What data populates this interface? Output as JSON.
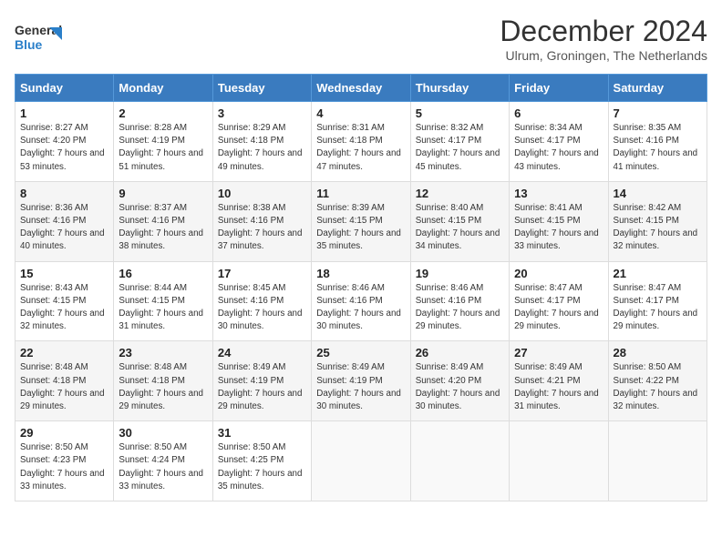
{
  "header": {
    "logo_line1": "General",
    "logo_line2": "Blue",
    "month": "December 2024",
    "location": "Ulrum, Groningen, The Netherlands"
  },
  "days_of_week": [
    "Sunday",
    "Monday",
    "Tuesday",
    "Wednesday",
    "Thursday",
    "Friday",
    "Saturday"
  ],
  "weeks": [
    [
      {
        "day": "1",
        "sunrise": "Sunrise: 8:27 AM",
        "sunset": "Sunset: 4:20 PM",
        "daylight": "Daylight: 7 hours and 53 minutes."
      },
      {
        "day": "2",
        "sunrise": "Sunrise: 8:28 AM",
        "sunset": "Sunset: 4:19 PM",
        "daylight": "Daylight: 7 hours and 51 minutes."
      },
      {
        "day": "3",
        "sunrise": "Sunrise: 8:29 AM",
        "sunset": "Sunset: 4:18 PM",
        "daylight": "Daylight: 7 hours and 49 minutes."
      },
      {
        "day": "4",
        "sunrise": "Sunrise: 8:31 AM",
        "sunset": "Sunset: 4:18 PM",
        "daylight": "Daylight: 7 hours and 47 minutes."
      },
      {
        "day": "5",
        "sunrise": "Sunrise: 8:32 AM",
        "sunset": "Sunset: 4:17 PM",
        "daylight": "Daylight: 7 hours and 45 minutes."
      },
      {
        "day": "6",
        "sunrise": "Sunrise: 8:34 AM",
        "sunset": "Sunset: 4:17 PM",
        "daylight": "Daylight: 7 hours and 43 minutes."
      },
      {
        "day": "7",
        "sunrise": "Sunrise: 8:35 AM",
        "sunset": "Sunset: 4:16 PM",
        "daylight": "Daylight: 7 hours and 41 minutes."
      }
    ],
    [
      {
        "day": "8",
        "sunrise": "Sunrise: 8:36 AM",
        "sunset": "Sunset: 4:16 PM",
        "daylight": "Daylight: 7 hours and 40 minutes."
      },
      {
        "day": "9",
        "sunrise": "Sunrise: 8:37 AM",
        "sunset": "Sunset: 4:16 PM",
        "daylight": "Daylight: 7 hours and 38 minutes."
      },
      {
        "day": "10",
        "sunrise": "Sunrise: 8:38 AM",
        "sunset": "Sunset: 4:16 PM",
        "daylight": "Daylight: 7 hours and 37 minutes."
      },
      {
        "day": "11",
        "sunrise": "Sunrise: 8:39 AM",
        "sunset": "Sunset: 4:15 PM",
        "daylight": "Daylight: 7 hours and 35 minutes."
      },
      {
        "day": "12",
        "sunrise": "Sunrise: 8:40 AM",
        "sunset": "Sunset: 4:15 PM",
        "daylight": "Daylight: 7 hours and 34 minutes."
      },
      {
        "day": "13",
        "sunrise": "Sunrise: 8:41 AM",
        "sunset": "Sunset: 4:15 PM",
        "daylight": "Daylight: 7 hours and 33 minutes."
      },
      {
        "day": "14",
        "sunrise": "Sunrise: 8:42 AM",
        "sunset": "Sunset: 4:15 PM",
        "daylight": "Daylight: 7 hours and 32 minutes."
      }
    ],
    [
      {
        "day": "15",
        "sunrise": "Sunrise: 8:43 AM",
        "sunset": "Sunset: 4:15 PM",
        "daylight": "Daylight: 7 hours and 32 minutes."
      },
      {
        "day": "16",
        "sunrise": "Sunrise: 8:44 AM",
        "sunset": "Sunset: 4:15 PM",
        "daylight": "Daylight: 7 hours and 31 minutes."
      },
      {
        "day": "17",
        "sunrise": "Sunrise: 8:45 AM",
        "sunset": "Sunset: 4:16 PM",
        "daylight": "Daylight: 7 hours and 30 minutes."
      },
      {
        "day": "18",
        "sunrise": "Sunrise: 8:46 AM",
        "sunset": "Sunset: 4:16 PM",
        "daylight": "Daylight: 7 hours and 30 minutes."
      },
      {
        "day": "19",
        "sunrise": "Sunrise: 8:46 AM",
        "sunset": "Sunset: 4:16 PM",
        "daylight": "Daylight: 7 hours and 29 minutes."
      },
      {
        "day": "20",
        "sunrise": "Sunrise: 8:47 AM",
        "sunset": "Sunset: 4:17 PM",
        "daylight": "Daylight: 7 hours and 29 minutes."
      },
      {
        "day": "21",
        "sunrise": "Sunrise: 8:47 AM",
        "sunset": "Sunset: 4:17 PM",
        "daylight": "Daylight: 7 hours and 29 minutes."
      }
    ],
    [
      {
        "day": "22",
        "sunrise": "Sunrise: 8:48 AM",
        "sunset": "Sunset: 4:18 PM",
        "daylight": "Daylight: 7 hours and 29 minutes."
      },
      {
        "day": "23",
        "sunrise": "Sunrise: 8:48 AM",
        "sunset": "Sunset: 4:18 PM",
        "daylight": "Daylight: 7 hours and 29 minutes."
      },
      {
        "day": "24",
        "sunrise": "Sunrise: 8:49 AM",
        "sunset": "Sunset: 4:19 PM",
        "daylight": "Daylight: 7 hours and 29 minutes."
      },
      {
        "day": "25",
        "sunrise": "Sunrise: 8:49 AM",
        "sunset": "Sunset: 4:19 PM",
        "daylight": "Daylight: 7 hours and 30 minutes."
      },
      {
        "day": "26",
        "sunrise": "Sunrise: 8:49 AM",
        "sunset": "Sunset: 4:20 PM",
        "daylight": "Daylight: 7 hours and 30 minutes."
      },
      {
        "day": "27",
        "sunrise": "Sunrise: 8:49 AM",
        "sunset": "Sunset: 4:21 PM",
        "daylight": "Daylight: 7 hours and 31 minutes."
      },
      {
        "day": "28",
        "sunrise": "Sunrise: 8:50 AM",
        "sunset": "Sunset: 4:22 PM",
        "daylight": "Daylight: 7 hours and 32 minutes."
      }
    ],
    [
      {
        "day": "29",
        "sunrise": "Sunrise: 8:50 AM",
        "sunset": "Sunset: 4:23 PM",
        "daylight": "Daylight: 7 hours and 33 minutes."
      },
      {
        "day": "30",
        "sunrise": "Sunrise: 8:50 AM",
        "sunset": "Sunset: 4:24 PM",
        "daylight": "Daylight: 7 hours and 33 minutes."
      },
      {
        "day": "31",
        "sunrise": "Sunrise: 8:50 AM",
        "sunset": "Sunset: 4:25 PM",
        "daylight": "Daylight: 7 hours and 35 minutes."
      },
      null,
      null,
      null,
      null
    ]
  ]
}
